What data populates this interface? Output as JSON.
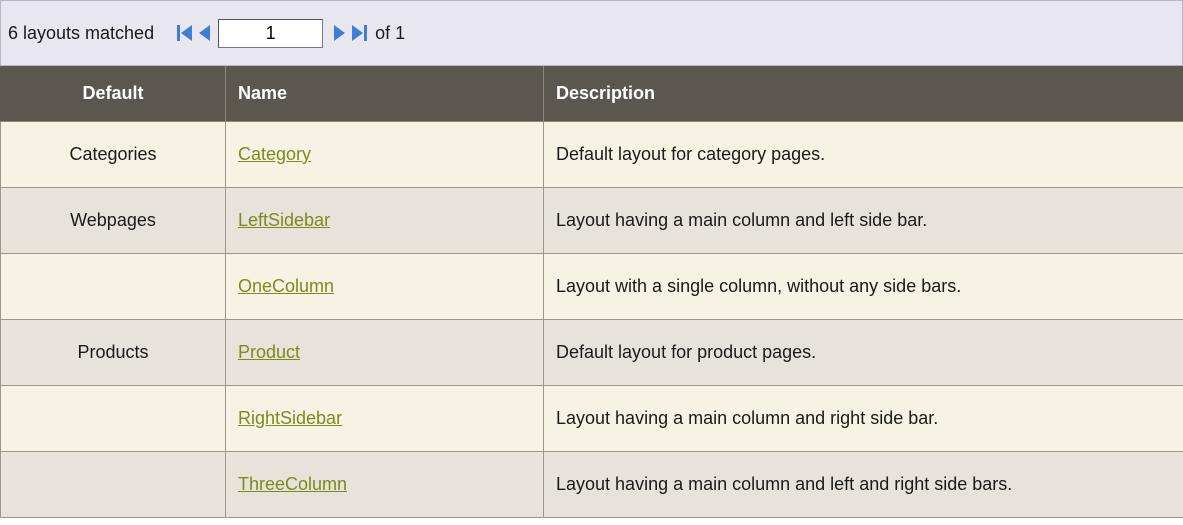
{
  "pager": {
    "matched_text": "6 layouts matched",
    "current_page": "1",
    "of_text": "of 1",
    "icons": [
      "first-page-icon",
      "prev-page-icon",
      "next-page-icon",
      "last-page-icon"
    ],
    "icon_color": "#3d7fd6"
  },
  "table": {
    "headers": {
      "default": "Default",
      "name": "Name",
      "description": "Description"
    },
    "rows": [
      {
        "default": "Categories",
        "name": "Category",
        "description": "Default layout for category pages."
      },
      {
        "default": "Webpages",
        "name": "LeftSidebar",
        "description": "Layout having a main column and left side bar."
      },
      {
        "default": "",
        "name": "OneColumn",
        "description": "Layout with a single column, without any side bars."
      },
      {
        "default": "Products",
        "name": "Product",
        "description": "Default layout for product pages."
      },
      {
        "default": "",
        "name": "RightSidebar",
        "description": "Layout having a main column and right side bar."
      },
      {
        "default": "",
        "name": "ThreeColumn",
        "description": "Layout having a main column and left and right side bars."
      }
    ]
  },
  "colors": {
    "header_bg": "#5b574f",
    "row_odd_bg": "#f6f3e4",
    "row_even_bg": "#e7e3da",
    "link": "#7d8a1f"
  }
}
